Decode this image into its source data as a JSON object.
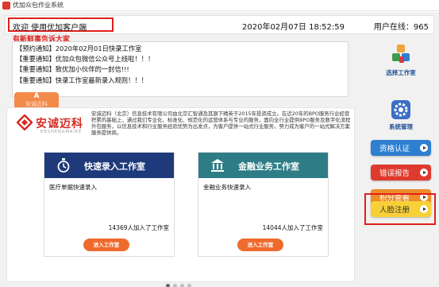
{
  "window": {
    "title": "优加众包作业系统",
    "icon": "app-icon"
  },
  "header": {
    "welcome": "欢迎 使用优加客户端",
    "datetime": "2020年02月07日  18:52:59",
    "online_count": "用户在线：965"
  },
  "notices": {
    "title": "有新鲜事告诉大家",
    "items": [
      "【预约通知】2020年02月01日快录工作室",
      "【重要通知】优加众包微信公众号上线啦！！！",
      "【重要通知】致优加小伙伴的一封信!!!",
      "【重要通知】快录工作室最新录入规则！！！"
    ]
  },
  "side_tools": [
    {
      "label": "选择工作室",
      "icon": "blocks-icon"
    },
    {
      "label": "系统管理",
      "icon": "gear-icon"
    }
  ],
  "tab": {
    "letter": "A",
    "label": "安诚迈科"
  },
  "company": {
    "logo_text": "安诚迈科",
    "logo_sub": "ENSHENGMAIKE",
    "intro": "安诚迈科（北京）信息技术有限公司由北京汇智通及其旗下精英于2015年投资成立。在近20年的BPO服务行业经营积累的基础上，通过我们专业化、标准化、规范化的运营体系与专业的服务，面向全行业提供BPO服务及数字化流程外包服务，以信息技术和行业服务经验优势为出发点，为客户提供一站式行业服务，努力成为客户的一站式解决方案服务提供商。"
  },
  "studios": [
    {
      "title": "快速录入工作室",
      "sub": "医疗单据快速录入",
      "count": "14369人加入了工作室",
      "button": "进入工作室",
      "icon": "stopwatch-icon",
      "color": "#1f3a7a"
    },
    {
      "title": "金融业务工作室",
      "sub": "金融业务快速录入",
      "count": "14044人加入了工作室",
      "button": "进入工作室",
      "icon": "bank-icon",
      "color": "#2e7d86"
    }
  ],
  "carousel": {
    "page_count": 4,
    "active": 0
  },
  "actions": [
    {
      "label": "资格认证",
      "bg": "#2f7fd1",
      "text_color": "#ffffff"
    },
    {
      "label": "错误报告",
      "bg": "#de3a2d",
      "text_color": "#ffffff"
    },
    {
      "label": "积分查看",
      "bg": "#ef8c2a",
      "text_color": "#ffffff"
    },
    {
      "label": "人脸注册",
      "bg": "#f7d038",
      "text_color": "#333333"
    }
  ],
  "colors": {
    "accent_red": "#e0201c",
    "enter_button": "#ef6b2d"
  }
}
